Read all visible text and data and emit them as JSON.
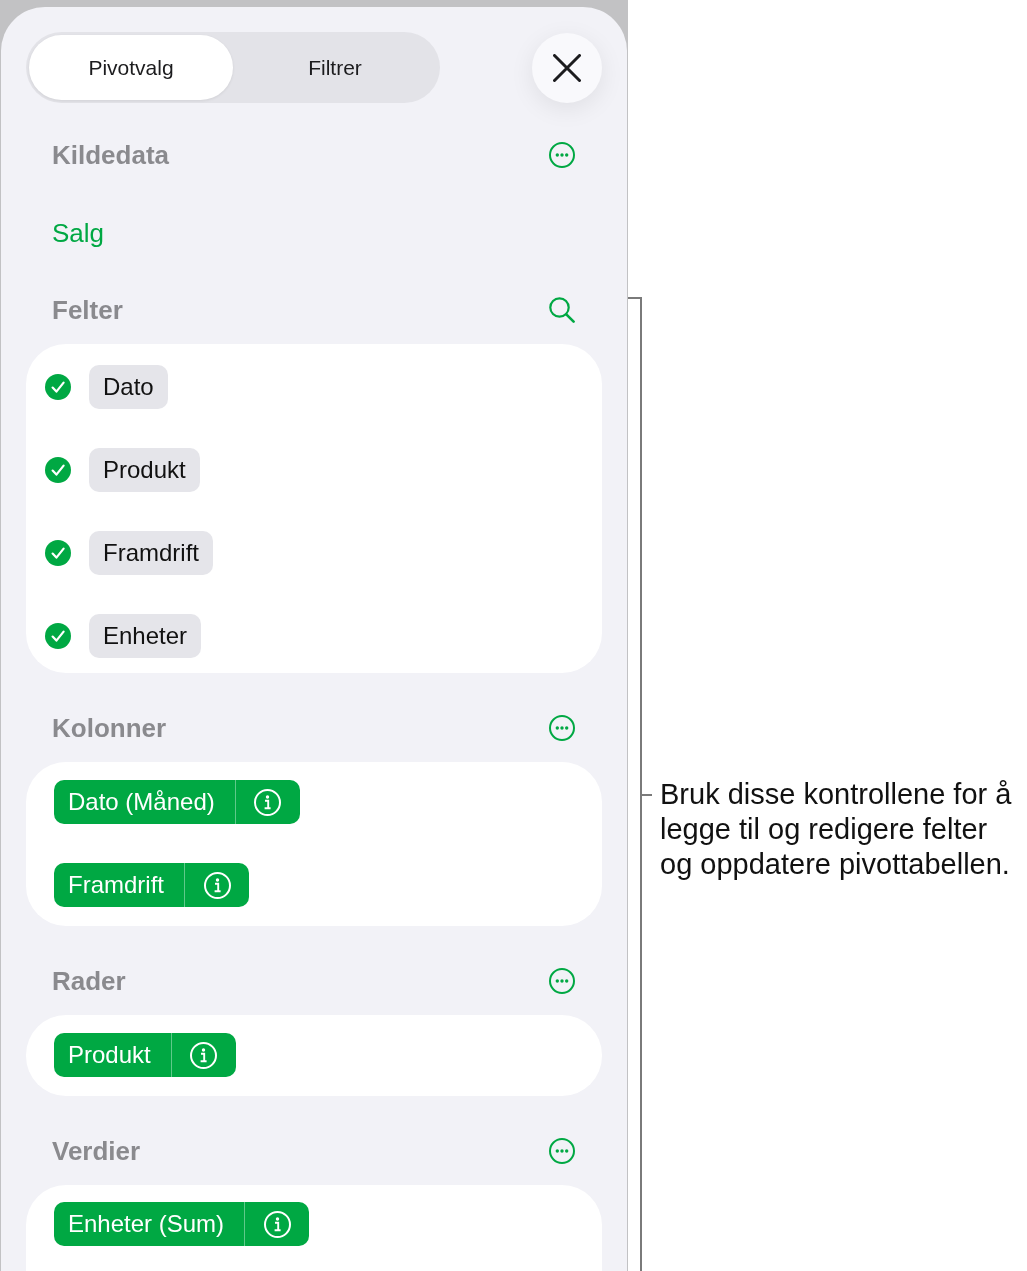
{
  "tabs": [
    {
      "label": "Pivotvalg",
      "selected": true
    },
    {
      "label": "Filtrer",
      "selected": false
    }
  ],
  "sections": [
    {
      "kind": "source",
      "title": "Kildedata",
      "value": "Salg"
    },
    {
      "kind": "fields",
      "title": "Felter",
      "items": [
        {
          "label": "Dato",
          "checked": true
        },
        {
          "label": "Produkt",
          "checked": true
        },
        {
          "label": "Framdrift",
          "checked": true
        },
        {
          "label": "Enheter",
          "checked": true
        }
      ]
    },
    {
      "kind": "pills",
      "title": "Kolonner",
      "items": [
        {
          "label": "Dato (Måned)"
        },
        {
          "label": "Framdrift"
        }
      ]
    },
    {
      "kind": "pills",
      "title": "Rader",
      "items": [
        {
          "label": "Produkt"
        }
      ]
    },
    {
      "kind": "pills",
      "title": "Verdier",
      "items": [
        {
          "label": "Enheter (Sum)"
        }
      ]
    }
  ],
  "callout": {
    "lines": [
      "Bruk disse kontrollene for å",
      "legge til og redigere felter",
      "og oppdatere pivottabellen."
    ]
  }
}
